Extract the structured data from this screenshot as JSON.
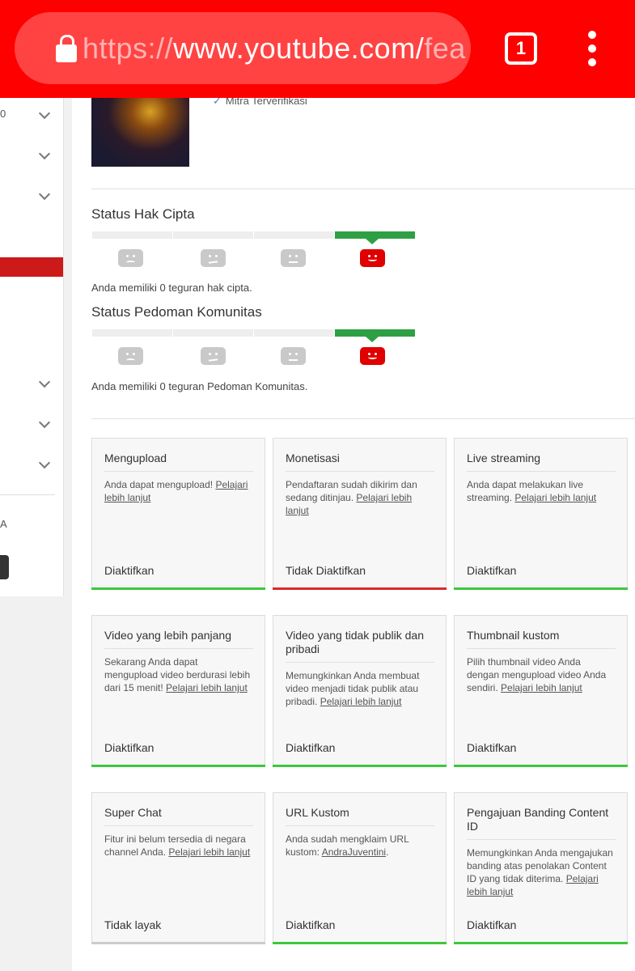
{
  "browser": {
    "url_scheme": "https://",
    "url_host": "www.youtube.com/",
    "url_path_fragment": "fea",
    "tab_count": "1"
  },
  "channel": {
    "verified_label": "Mitra Terverifikasi"
  },
  "sidebar": {
    "fragment_top": "0",
    "fragment_a": "A"
  },
  "copyright_status": {
    "title": "Status Hak Cipta",
    "strikes_text": "Anda memiliki 0 teguran hak cipta."
  },
  "community_status": {
    "title": "Status Pedoman Komunitas",
    "strikes_text": "Anda memiliki 0 teguran Pedoman Komunitas."
  },
  "features": [
    {
      "title": "Mengupload",
      "desc": "Anda dapat mengupload!",
      "link": "Pelajari lebih lanjut",
      "status": "Diaktifkan",
      "bar_color": "#3cc83c"
    },
    {
      "title": "Monetisasi",
      "desc": "Pendaftaran sudah dikirim dan sedang ditinjau.",
      "link": "Pelajari lebih lanjut",
      "status": "Tidak Diaktifkan",
      "bar_color": "#d92b2b"
    },
    {
      "title": "Live streaming",
      "desc": "Anda dapat melakukan live streaming.",
      "link": "Pelajari lebih lanjut",
      "status": "Diaktifkan",
      "bar_color": "#3cc83c"
    },
    {
      "title": "Video yang lebih panjang",
      "desc": "Sekarang Anda dapat mengupload video berdurasi lebih dari 15 menit!",
      "link": "Pelajari lebih lanjut",
      "status": "Diaktifkan",
      "bar_color": "#3cc83c"
    },
    {
      "title": "Video yang tidak publik dan pribadi",
      "desc": "Memungkinkan Anda membuat video menjadi tidak publik atau pribadi.",
      "link": "Pelajari lebih lanjut",
      "status": "Diaktifkan",
      "bar_color": "#3cc83c"
    },
    {
      "title": "Thumbnail kustom",
      "desc": "Pilih thumbnail video Anda dengan mengupload video Anda sendiri.",
      "link": "Pelajari lebih lanjut",
      "status": "Diaktifkan",
      "bar_color": "#3cc83c"
    },
    {
      "title": "Super Chat",
      "desc": "Fitur ini belum tersedia di negara channel Anda.",
      "link": "Pelajari lebih lanjut",
      "status": "Tidak layak",
      "bar_color": "#cccccc"
    },
    {
      "title": "URL Kustom",
      "desc": "Anda sudah mengklaim URL kustom:",
      "link": "AndraJuventini",
      "suffix": ".",
      "status": "Diaktifkan",
      "bar_color": "#3cc83c"
    },
    {
      "title": "Pengajuan Banding Content ID",
      "desc": "Memungkinkan Anda mengajukan banding atas penolakan Content ID yang tidak diterima.",
      "link": "Pelajari lebih lanjut",
      "status": "Diaktifkan",
      "bar_color": "#3cc83c"
    }
  ]
}
